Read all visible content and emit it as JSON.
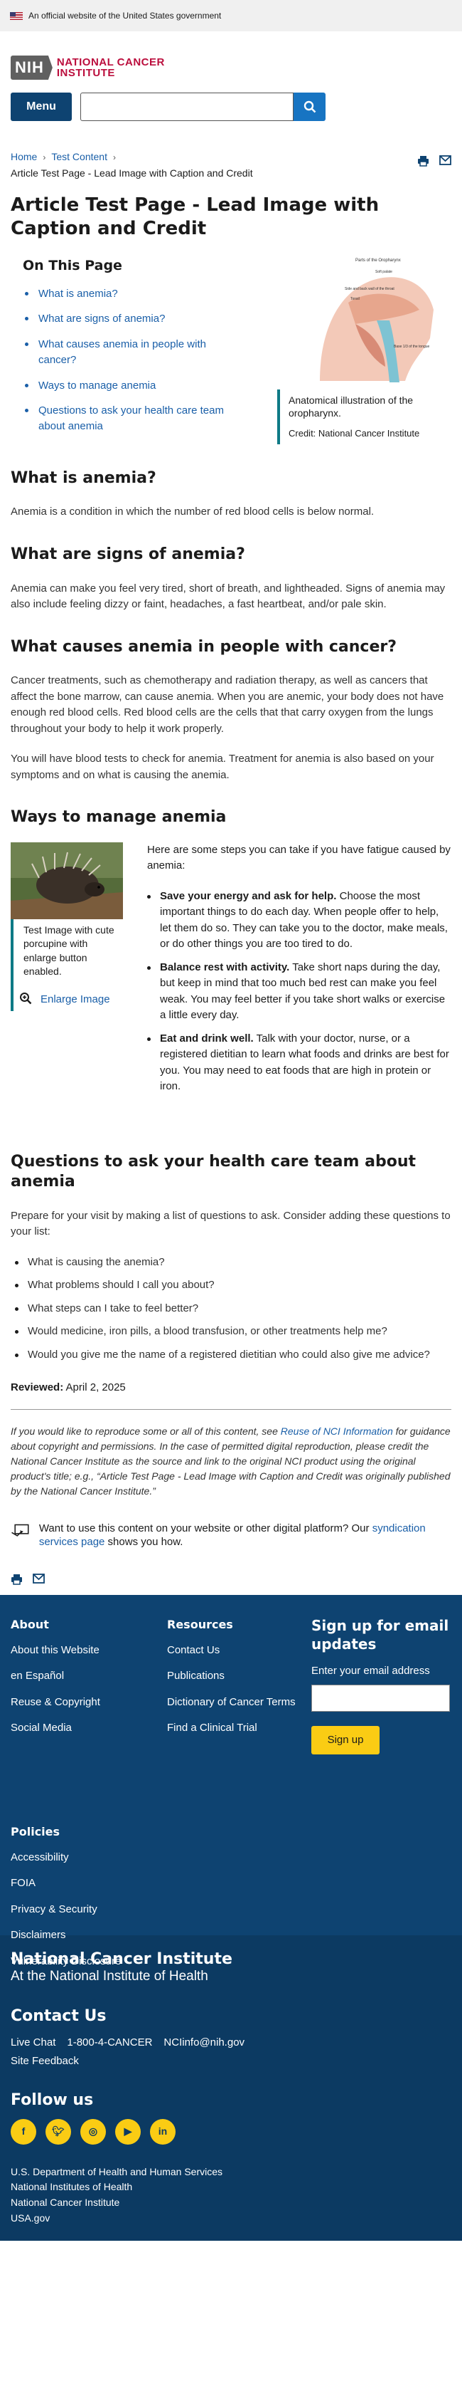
{
  "gov_banner": {
    "text": "An official website of the United States government"
  },
  "logo": {
    "nih": "NIH",
    "line1": "NATIONAL CANCER",
    "line2": "INSTITUTE"
  },
  "header": {
    "menu_label": "Menu",
    "search_placeholder": ""
  },
  "breadcrumb": {
    "items": [
      "Home",
      "Test Content"
    ],
    "current": "Article Test Page - Lead Image with Caption and Credit"
  },
  "page_title": "Article Test Page - Lead Image with Caption and Credit",
  "on_this_page": {
    "heading": "On This Page",
    "links": [
      "What is anemia?",
      "What are signs of anemia?",
      "What causes anemia in people with cancer?",
      "Ways to manage anemia",
      "Questions to ask your health care team about anemia"
    ]
  },
  "lead_image": {
    "diagram_title": "Parts of the Oropharynx",
    "labels": [
      "Soft palate",
      "Side and back wall of the throat",
      "Tonsil",
      "Base 1/3 of the tongue"
    ],
    "caption": "Anatomical illustration of the oropharynx.",
    "credit": "Credit: National Cancer Institute"
  },
  "sections": {
    "what_is": {
      "heading": "What is anemia?",
      "text": "Anemia is a condition in which the number of red blood cells is below normal."
    },
    "signs": {
      "heading": "What are signs of anemia?",
      "text": "Anemia can make you feel very tired, short of breath, and lightheaded. Signs of anemia may also include feeling dizzy or faint, headaches, a fast heartbeat, and/or pale skin."
    },
    "causes": {
      "heading": "What causes anemia in people with cancer?",
      "p1": "Cancer treatments, such as chemotherapy and radiation therapy, as well as cancers that affect the bone marrow, can cause anemia. When you are anemic, your body does not have enough red blood cells. Red blood cells are the cells that that carry oxygen from the lungs throughout your body to help it work properly.",
      "p2": "You will have blood tests to check for anemia. Treatment for anemia is also based on your symptoms and on what is causing the anemia."
    },
    "manage": {
      "heading": "Ways to manage anemia",
      "image_caption": "Test Image with cute porcupine with enlarge button enabled.",
      "enlarge_label": "Enlarge Image",
      "intro": "Here are some steps you can take if you have fatigue caused by anemia:",
      "tips": [
        {
          "bold": "Save your energy and ask for help.",
          "text": " Choose the most important things to do each day. When people offer to help, let them do so. They can take you to the doctor, make meals, or do other things you are too tired to do."
        },
        {
          "bold": "Balance rest with activity.",
          "text": " Take short naps during the day, but keep in mind that too much bed rest can make you feel weak. You may feel better if you take short walks or exercise a little every day."
        },
        {
          "bold": "Eat and drink well.",
          "text": " Talk with your doctor, nurse, or a registered dietitian to learn what foods and drinks are best for you. You may need to eat foods that are high in protein or iron."
        }
      ]
    },
    "questions": {
      "heading": "Questions to ask your health care team about anemia",
      "intro": "Prepare for your visit by making a list of questions to ask. Consider adding these questions to your list:",
      "items": [
        "What is causing the anemia?",
        "What problems should I call you about?",
        "What steps can I take to feel better?",
        "Would medicine, iron pills, a blood transfusion, or other treatments help me?",
        "Would you give me the name of a registered dietitian who could also give me advice?"
      ]
    }
  },
  "reviewed": {
    "label": "Reviewed:",
    "date": "April 2, 2025"
  },
  "reuse": {
    "pre": "If you would like to reproduce some or all of this content, see ",
    "link": "Reuse of NCI Information",
    "post": " for guidance about copyright and permissions. In the case of permitted digital reproduction, please credit the National Cancer Institute as the source and link to the original NCI product using the original product's title; e.g., “Article Test Page - Lead Image with Caption and Credit was originally published by the National Cancer Institute.”"
  },
  "embed": {
    "pre": "Want to use this content on your website or other digital platform? Our ",
    "link": "syndication services page",
    "post": " shows you how."
  },
  "footer": {
    "about": {
      "heading": "About",
      "links": [
        "About this Website",
        "en Español",
        "Reuse & Copyright",
        "Social Media"
      ]
    },
    "resources": {
      "heading": "Resources",
      "links": [
        "Contact Us",
        "Publications",
        "Dictionary of Cancer Terms",
        "Find a Clinical Trial"
      ]
    },
    "policies": {
      "heading": "Policies",
      "links": [
        "Accessibility",
        "FOIA",
        "Privacy & Security",
        "Disclaimers",
        "Vulnerability Disclosure"
      ]
    },
    "signup": {
      "heading": "Sign up for email updates",
      "label": "Enter your email address",
      "button": "Sign up"
    },
    "org": "National Cancer Institute",
    "org_sub": "At the National Institute of Health",
    "contact_heading": "Contact Us",
    "contact": [
      "Live Chat",
      "1-800-4-CANCER",
      "NCIinfo@nih.gov"
    ],
    "feedback": "Site Feedback",
    "follow_heading": "Follow us",
    "social": [
      "facebook-icon",
      "twitter-icon",
      "instagram-icon",
      "youtube-icon",
      "linkedin-icon"
    ],
    "agencies": [
      "U.S. Department of Health and Human Services",
      "National Institutes of Health",
      "National Cancer Institute",
      "USA.gov"
    ]
  }
}
